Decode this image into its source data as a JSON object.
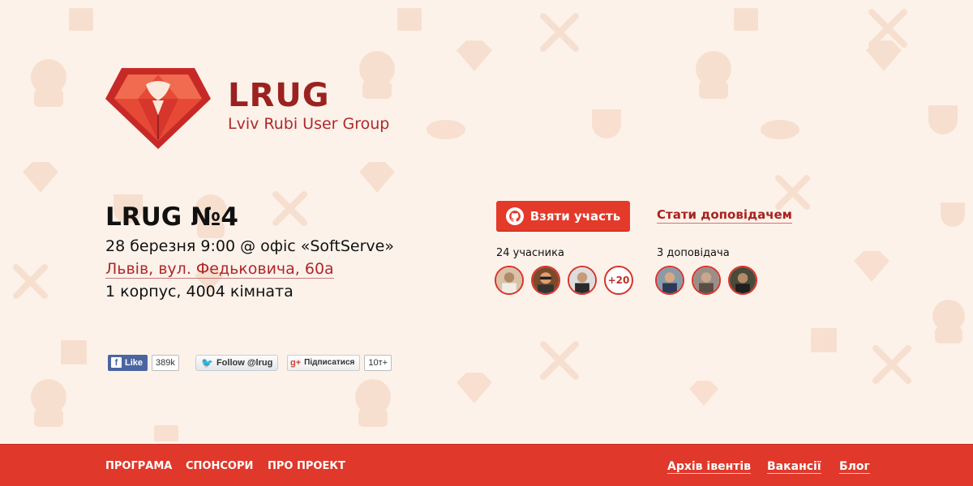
{
  "brand": {
    "name": "LRUG",
    "subtitle": "Lviv Rubi User Group"
  },
  "event": {
    "title": "LRUG №4",
    "date_line": "28 березня 9:00 @ офіс «SoftServe»",
    "address": "Львів, вул. Федьковича, 60а",
    "room": "1 корпус, 4004 кімната"
  },
  "actions": {
    "join_label": "Взяти участь",
    "become_speaker_label": "Стати доповідачем"
  },
  "participants": {
    "label": "24 учасника",
    "more": "+20"
  },
  "speakers": {
    "label": "3 доповідача"
  },
  "social": {
    "facebook": {
      "label": "Like",
      "count": "389k"
    },
    "twitter": {
      "label": "Follow @lrug"
    },
    "gplus": {
      "label": "Підписатися",
      "count": "10т+"
    }
  },
  "footer": {
    "left": [
      "ПРОГРАМА",
      "СПОНСОРИ",
      "ПРО ПРОЕКТ"
    ],
    "right": [
      "Архів івентів",
      "Вакансії",
      "Блог"
    ]
  },
  "colors": {
    "accent": "#e0382b",
    "brand_dark": "#9b2220",
    "background": "#fdf2ea"
  },
  "icons": {
    "join_button": "github-octocat-icon",
    "background_pattern": [
      "octocat-icon",
      "wrench-screwdriver-icon",
      "diamond-icon",
      "coffee-cup-icon",
      "box-icon",
      "cloud-icon"
    ]
  }
}
